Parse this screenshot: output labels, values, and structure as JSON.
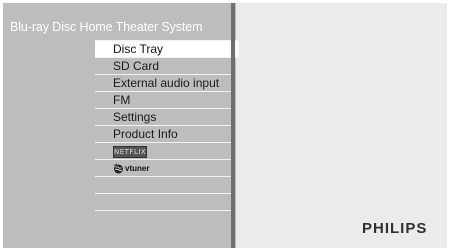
{
  "header": {
    "title": "Blu-ray Disc Home Theater System"
  },
  "menu": {
    "selected_index": 0,
    "items": [
      {
        "label": "Disc Tray"
      },
      {
        "label": "SD Card"
      },
      {
        "label": "External audio input"
      },
      {
        "label": "FM"
      },
      {
        "label": "Settings"
      },
      {
        "label": "Product Info"
      },
      {
        "label": "NETFLIX",
        "icon": "netflix-logo-icon"
      },
      {
        "label": "vtuner",
        "icon": "vtuner-globe-icon"
      },
      {
        "label": ""
      },
      {
        "label": ""
      }
    ]
  },
  "brand": {
    "name": "PHILIPS"
  },
  "colors": {
    "left_panel": "#bdbdbd",
    "right_panel": "#ebebeb",
    "divider": "#6f6f6f",
    "selection": "#ffffff"
  }
}
